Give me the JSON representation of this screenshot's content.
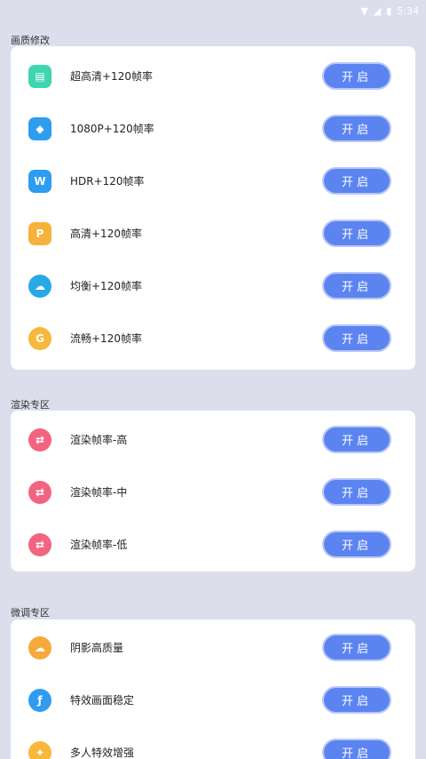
{
  "status": {
    "time": "5:34"
  },
  "sections": [
    {
      "title": "画质修改",
      "items": [
        {
          "label": "超高清+120帧率",
          "icon": "tablet-icon",
          "icon_color": "#3dd6b0",
          "button": "开启"
        },
        {
          "label": "1080P+120帧率",
          "icon": "layers-icon",
          "icon_color": "#2e9cf0",
          "button": "开启"
        },
        {
          "label": "HDR+120帧率",
          "icon": "w-letter-icon",
          "icon_color": "#2e9cf0",
          "button": "开启"
        },
        {
          "label": "高清+120帧率",
          "icon": "p-letter-icon",
          "icon_color": "#f7b23b",
          "button": "开启"
        },
        {
          "label": "均衡+120帧率",
          "icon": "cloud-icon",
          "icon_color": "#29a8e8",
          "button": "开启"
        },
        {
          "label": "流畅+120帧率",
          "icon": "g-letter-icon",
          "icon_color": "#f7b83b",
          "button": "开启"
        }
      ]
    },
    {
      "title": "渲染专区",
      "items": [
        {
          "label": "渲染帧率-高",
          "icon": "render-icon",
          "icon_color": "#f26480",
          "button": "开启"
        },
        {
          "label": "渲染帧率-中",
          "icon": "render-icon",
          "icon_color": "#f26480",
          "button": "开启"
        },
        {
          "label": "渲染帧率-低",
          "icon": "render-icon",
          "icon_color": "#f26480",
          "button": "开启"
        }
      ]
    },
    {
      "title": "微调专区",
      "items": [
        {
          "label": "阴影高质量",
          "icon": "cloud-sun-icon",
          "icon_color": "#f7a93b",
          "button": "开启"
        },
        {
          "label": "特效画面稳定",
          "icon": "feather-icon",
          "icon_color": "#2e9cf0",
          "button": "开启"
        },
        {
          "label": "多人特效增强",
          "icon": "spark-icon",
          "icon_color": "#f7b83b",
          "button": "开启"
        }
      ]
    }
  ]
}
